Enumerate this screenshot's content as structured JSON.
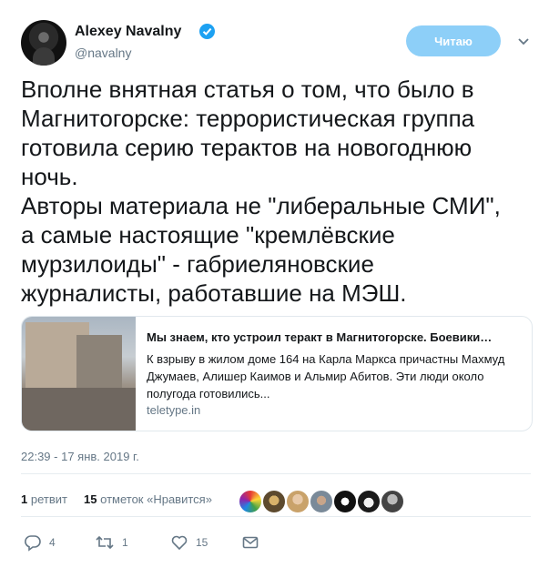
{
  "author": {
    "name": "Alexey Navalny",
    "handle": "@navalny",
    "verified": true
  },
  "follow_button": {
    "label": "Читаю",
    "color": "#8dcff8"
  },
  "tweet_text": [
    "Вполне внятная статья о том, что было в",
    "Магнитогорске: террористическая группа",
    "готовила серию терактов на новогоднюю",
    "ночь.",
    "Авторы материала не \"либеральные СМИ\",",
    "а самые настоящие \"кремлёвские",
    "мурзилоиды\" - габриеляновские",
    "журналисты, работавшие на МЭШ."
  ],
  "card": {
    "title": "Мы знаем, кто устроил теракт в Магнитогорске. Боевики…",
    "description": "К взрыву в жилом доме 164 на Карла Маркса причастны Махмуд Джумаев, Алишер Каимов и Альмир Абитов. Эти люди около полугода готовились...",
    "domain": "teletype.in"
  },
  "timestamp": "22:39 - 17 янв. 2019 г.",
  "stats": {
    "retweets_count": "1",
    "retweets_label": "ретвит",
    "likes_count": "15",
    "likes_label": "отметок «Нравится»"
  },
  "likers": [
    "rainbow-avatar",
    "cat-avatar",
    "face-avatar",
    "beard-avatar",
    "dark-avatar",
    "monkey-avatar",
    "portrait-avatar"
  ],
  "actions": {
    "reply_count": "4",
    "retweet_count": "1",
    "like_count": "15"
  },
  "colors": {
    "accent": "#1da1f2",
    "muted": "#657786",
    "text": "#14171a"
  }
}
